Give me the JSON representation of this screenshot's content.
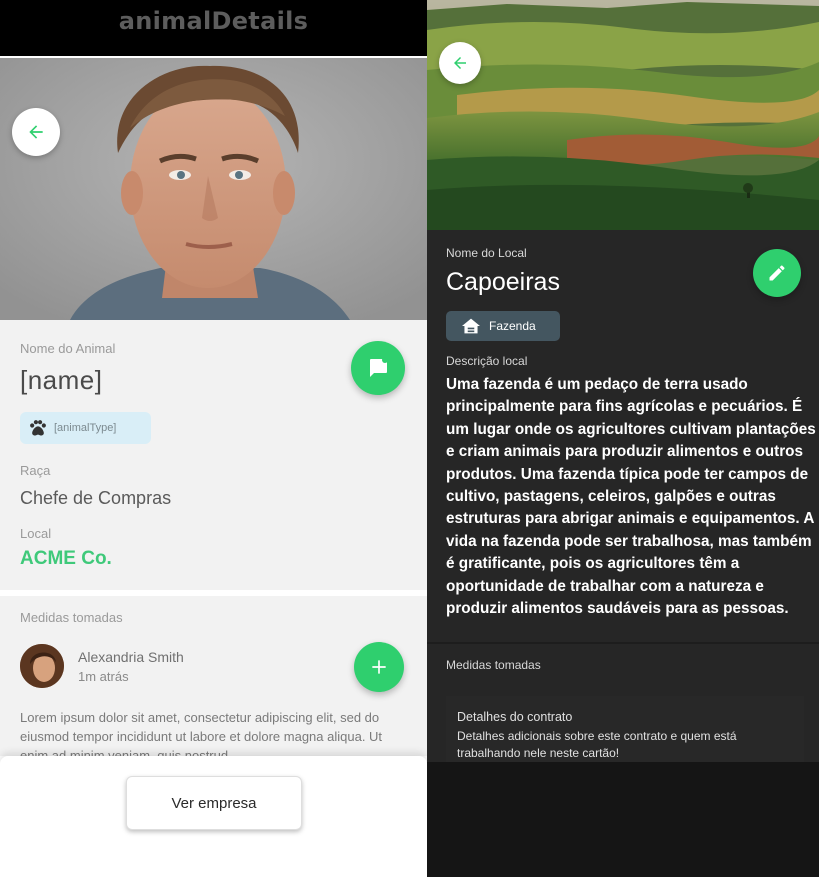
{
  "left_screen": {
    "title": "animalDetails",
    "name_label": "Nome do Animal",
    "name_value": "[name]",
    "type_chip": {
      "label": "[animalType]",
      "icon": "paw-icon"
    },
    "race_label": "Raça",
    "race_value": "Chefe de Compras",
    "local_label": "Local",
    "local_value": "ACME Co.",
    "measures_label": "Medidas tomadas",
    "measure_author": "Alexandria Smith",
    "measure_time": "1m atrás",
    "measure_text": "Lorem ipsum dolor sit amet, consectetur adipiscing elit, sed do eiusmod tempor incididunt ut labore et dolore magna aliqua. Ut enim ad minim veniam, quis nostrud",
    "view_company_button": "Ver empresa",
    "back_icon": "arrow-left-icon",
    "message_icon": "message-icon",
    "add_icon": "plus-icon"
  },
  "right_screen": {
    "place_label": "Nome do Local",
    "place_name": "Capoeiras",
    "type_chip": {
      "label": "Fazenda",
      "icon": "house-icon"
    },
    "description_label": "Descrição local",
    "description": "Uma fazenda é um pedaço de terra usado principalmente para fins agrícolas e pecuários. É um lugar onde os agricultores cultivam plantações e criam animais para produzir alimentos e outros produtos. Uma fazenda típica pode ter campos de cultivo, pastagens, celeiros, galpões e outras estruturas para abrigar animais e equipamentos. A vida na fazenda pode ser trabalhosa, mas também é gratificante, pois os agricultores têm a oportunidade de trabalhar com a natureza e produzir alimentos saudáveis para as pessoas.",
    "measures_label": "Medidas tomadas",
    "card_title": "Detalhes do contrato",
    "card_description": "Detalhes adicionais sobre este contrato e quem está trabalhando nele neste cartão!",
    "back_icon": "arrow-left-icon",
    "edit_icon": "pencil-icon"
  },
  "colors": {
    "accent_green": "#2fcf6e",
    "local_green": "#3fc97a",
    "chip_blue": "#d9eef7",
    "chip_slate": "#445660",
    "dark_bg": "#262626"
  }
}
